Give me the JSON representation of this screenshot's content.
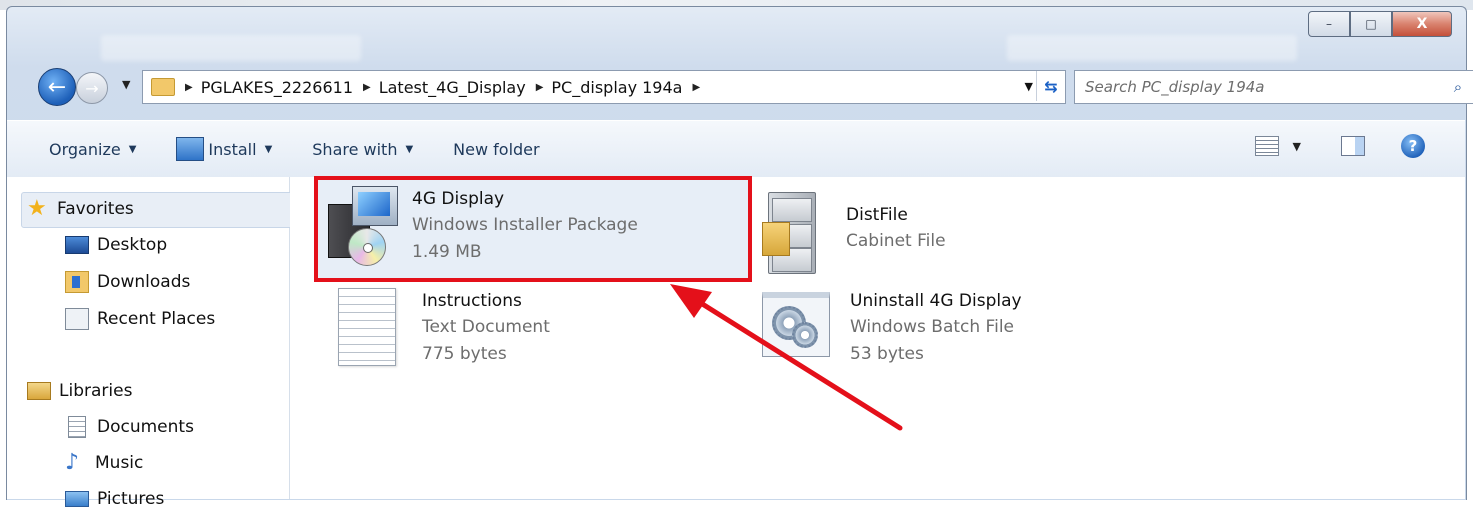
{
  "window": {
    "caption_buttons": [
      "–",
      "□",
      "X"
    ]
  },
  "nav": {
    "breadcrumbs": [
      "PGLAKES_2226611",
      "Latest_4G_Display",
      "PC_display 194a"
    ],
    "search_placeholder": "Search PC_display 194a"
  },
  "toolbar": {
    "organize": "Organize",
    "install": "Install",
    "share_with": "Share with",
    "new_folder": "New folder"
  },
  "sidebar": {
    "favorites": "Favorites",
    "items": [
      "Desktop",
      "Downloads",
      "Recent Places"
    ],
    "libraries": "Libraries",
    "lib_items": [
      "Documents",
      "Music",
      "Pictures"
    ]
  },
  "files": [
    {
      "name": "4G Display",
      "type": "Windows Installer Package",
      "size": "1.49 MB",
      "icon": "installer-package-icon",
      "selected": true
    },
    {
      "name": "DistFile",
      "type": "Cabinet File",
      "icon": "cabinet-file-icon"
    },
    {
      "name": "Instructions",
      "type": "Text Document",
      "size": "775 bytes",
      "icon": "text-document-icon"
    },
    {
      "name": "Uninstall 4G Display",
      "type": "Windows Batch File",
      "size": "53 bytes",
      "icon": "batch-file-icon"
    }
  ],
  "colors": {
    "highlight_box": "#e4101a",
    "annotation_arrow": "#e4101a",
    "selection": "#e7eef7"
  }
}
